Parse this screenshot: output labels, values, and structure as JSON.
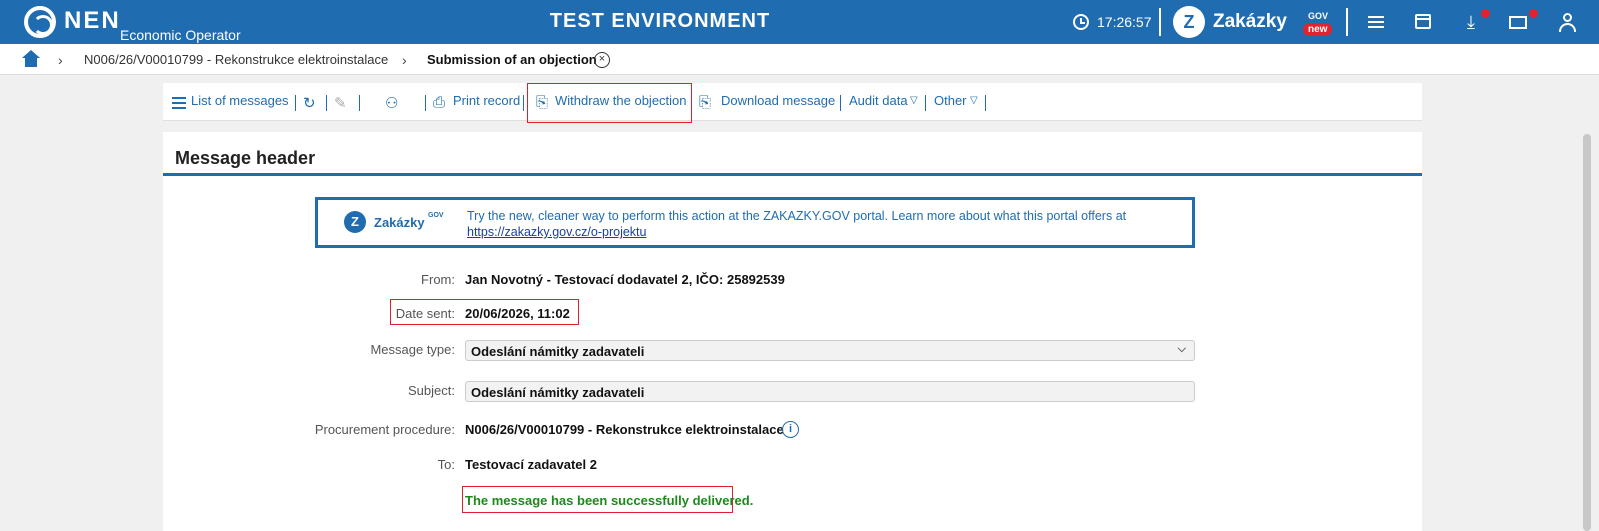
{
  "header": {
    "logo_text": "NEN",
    "logo_subtitle": "Economic Operator",
    "environment": "TEST ENVIRONMENT",
    "time": "17:26:57",
    "zakazky_label": "Zakázky",
    "zakazky_gov": "GOV",
    "zakazky_badge": "new"
  },
  "breadcrumb": {
    "item1": "N006/26/V00010799 - Rekonstrukce elektroinstalace",
    "item2": "Submission of an objection",
    "close_glyph": "×"
  },
  "toolbar": {
    "list_messages": "List of messages",
    "print_record": "Print record",
    "withdraw": "Withdraw the objection",
    "download_message": "Download message",
    "audit_data": "Audit data",
    "other": "Other"
  },
  "panel": {
    "title": "Message header"
  },
  "promo": {
    "brand": "Zakázky",
    "brand_sup": "GOV",
    "text": "Try the new, cleaner way to perform this action at the ZAKAZKY.GOV portal. Learn more about what this portal offers at",
    "link": "https://zakazky.gov.cz/o-projektu"
  },
  "message": {
    "from_label": "From:",
    "from_value": "Jan Novotný - Testovací dodavatel 2, IČO: 25892539",
    "date_label": "Date sent:",
    "date_value": "20/06/2026, 11:02",
    "type_label": "Message type:",
    "type_value": "Odeslání námitky zadavateli",
    "subject_label": "Subject:",
    "subject_value": "Odeslání námitky zadavateli",
    "procedure_label": "Procurement procedure:",
    "procedure_value": "N006/26/V00010799 - Rekonstrukce elektroinstalace",
    "to_label": "To:",
    "to_value": "Testovací zadavatel 2",
    "status": "The message has been successfully delivered."
  },
  "colors": {
    "brand_blue": "#1f6cb0",
    "highlight_red": "#e02030",
    "success_green": "#1b8a1b"
  }
}
